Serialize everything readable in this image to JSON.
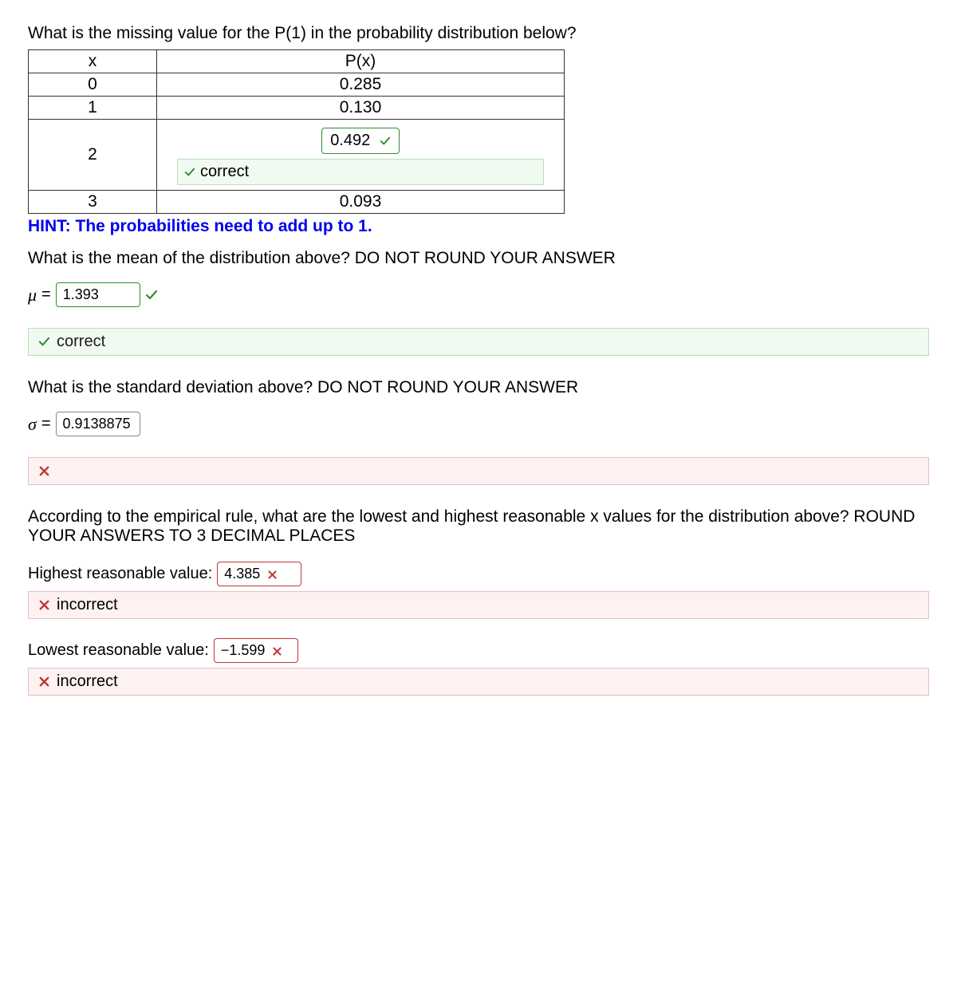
{
  "q1": {
    "prompt": "What is the missing value for the P(1) in the probability distribution below?",
    "table": {
      "head_x": "x",
      "head_p": "P(x)",
      "rows": [
        {
          "x": "0",
          "p": "0.285"
        },
        {
          "x": "1",
          "p": "0.130"
        }
      ],
      "answer_row": {
        "x": "2",
        "value": "0.492",
        "status": "correct"
      },
      "last_row": {
        "x": "3",
        "p": "0.093"
      }
    },
    "hint": "HINT: The probabilities need to add up to 1."
  },
  "q2": {
    "prompt": "What is the mean of the distribution above? DO NOT ROUND YOUR ANSWER",
    "symbol": "μ",
    "value": "1.393",
    "status": "correct"
  },
  "q3": {
    "prompt": "What is the standard deviation above? DO NOT ROUND YOUR ANSWER",
    "symbol": "σ",
    "value": "0.9138875",
    "status_blank": ""
  },
  "q4": {
    "prompt": "According to the empirical rule, what are the lowest and highest reasonable x values for the distribution above? ROUND YOUR ANSWERS TO 3 DECIMAL PLACES",
    "highest_label": "Highest reasonable value:",
    "highest_value": "4.385",
    "highest_status": "incorrect",
    "lowest_label": "Lowest reasonable value:",
    "lowest_value": "−1.599",
    "lowest_status": "incorrect"
  },
  "labels": {
    "correct": "correct",
    "incorrect": "incorrect"
  }
}
